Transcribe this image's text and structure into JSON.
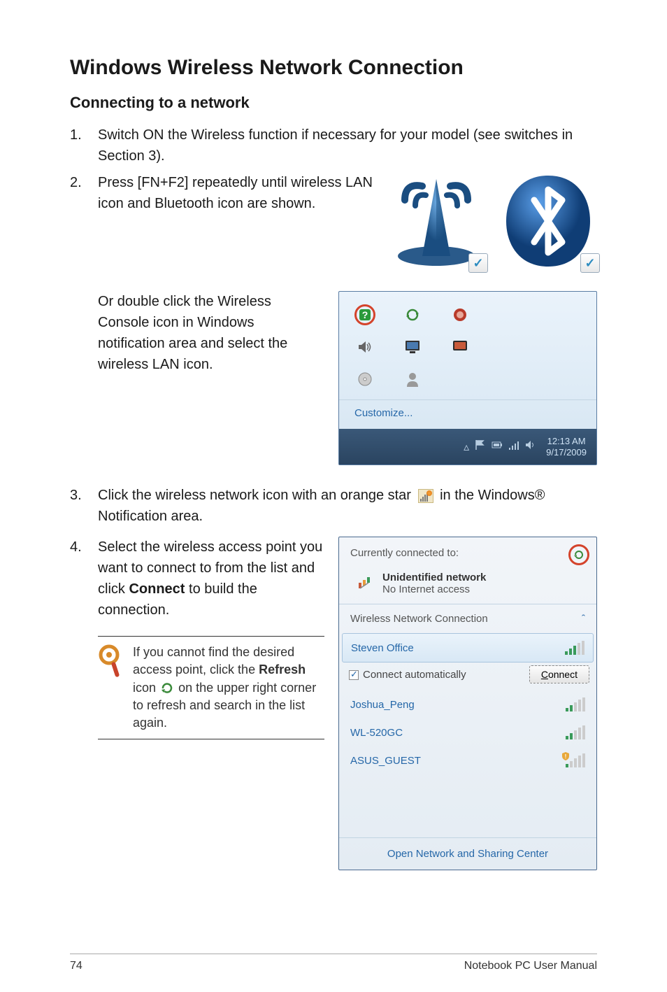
{
  "title": "Windows Wireless Network Connection",
  "subtitle": "Connecting to a network",
  "steps": {
    "s1": {
      "num": "1.",
      "text": "Switch ON the Wireless function if necessary for your model (see switches in Section 3)."
    },
    "s2": {
      "num": "2.",
      "text": "Press [FN+F2] repeatedly until wireless LAN icon and Bluetooth icon are shown."
    },
    "s2b": "Or double click the Wireless Console icon in Windows notification area and select the wireless LAN icon.",
    "s3": {
      "num": "3.",
      "pre": "Click the wireless network icon with an orange star",
      "post": "in the Windows® Notification area."
    },
    "s4": {
      "num": "4.",
      "text_a": "Select the wireless access point you want to connect to from the list and click ",
      "bold": "Connect",
      "text_b": " to build the connection."
    }
  },
  "note": {
    "text_a": "If you cannot find the desired access point, click the ",
    "bold": "Refresh",
    "text_b": " icon",
    "text_c": "on the upper right corner to refresh and search in the list again."
  },
  "tray": {
    "customize": "Customize...",
    "time": "12:13 AM",
    "date": "9/17/2009"
  },
  "wifi": {
    "currently": "Currently connected to:",
    "unidentified": "Unidentified network",
    "noaccess": "No Internet access",
    "section": "Wireless Network Connection",
    "net1": "Steven Office",
    "auto": "Connect automatically",
    "connect": "Connect",
    "net2": "Joshua_Peng",
    "net3": "WL-520GC",
    "net4": "ASUS_GUEST",
    "footer": "Open Network and Sharing Center"
  },
  "page": {
    "num": "74",
    "label": "Notebook PC User Manual"
  }
}
